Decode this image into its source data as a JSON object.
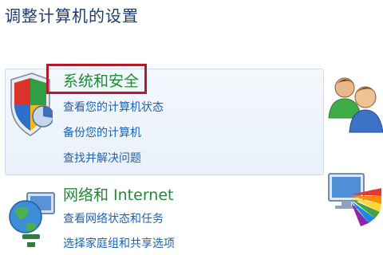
{
  "page_title": "调整计算机的设置",
  "categories": [
    {
      "icon": "security-shield-icon",
      "title": "系统和安全",
      "links": [
        "查看您的计算机状态",
        "备份您的计算机",
        "查找并解决问题"
      ]
    },
    {
      "icon": "network-globe-icon",
      "title": "网络和 Internet",
      "links": [
        "查看网络状态和任务",
        "选择家庭组和共享选项"
      ]
    }
  ],
  "right_icons": [
    "user-accounts-icon",
    "appearance-icon"
  ],
  "colors": {
    "title": "#1e3b6e",
    "category_title": "#1f8a36",
    "link": "#1a63b0",
    "highlight_border": "#b01c2c"
  }
}
